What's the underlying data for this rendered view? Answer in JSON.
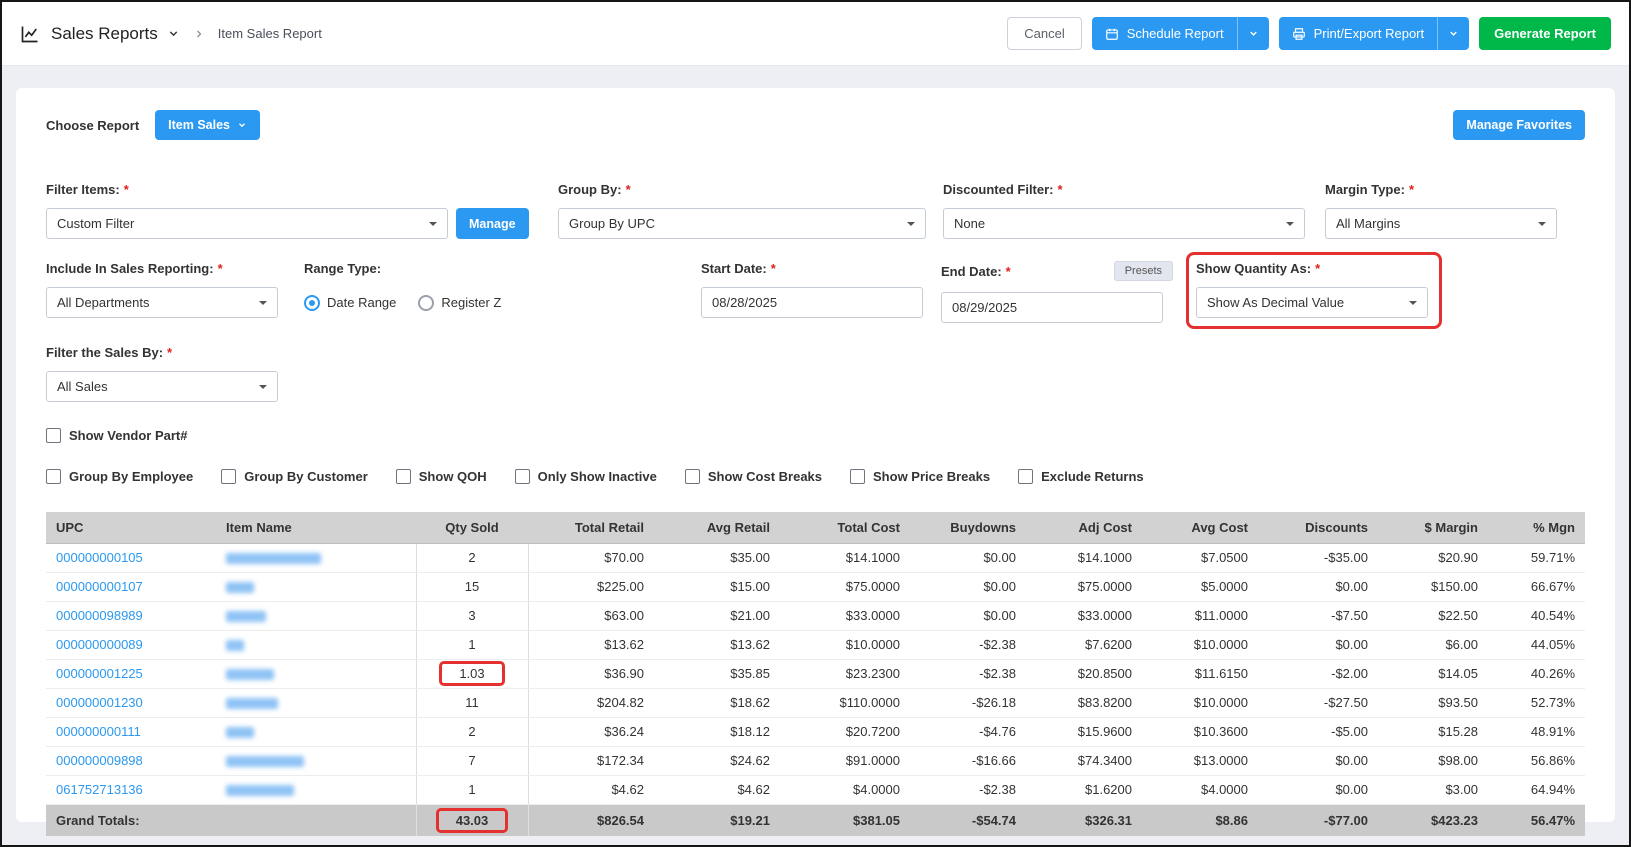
{
  "ui_colors": {
    "primary_blue": "#2b99f1",
    "success_green": "#00b74a",
    "annotation_red": "#e53030",
    "link_blue": "#2b99f1"
  },
  "required_marker": "*",
  "topbar": {
    "title": "Sales Reports",
    "breadcrumb": "Item Sales Report",
    "cancel": "Cancel",
    "schedule": "Schedule Report",
    "print_export": "Print/Export Report",
    "generate": "Generate Report"
  },
  "report_picker": {
    "label": "Choose Report",
    "selected": "Item Sales",
    "manage_favorites": "Manage Favorites"
  },
  "filters": {
    "filter_items": {
      "label": "Filter Items:",
      "value": "Custom Filter",
      "manage": "Manage"
    },
    "group_by": {
      "label": "Group By:",
      "value": "Group By UPC"
    },
    "discounted_filter": {
      "label": "Discounted Filter:",
      "value": "None"
    },
    "margin_type": {
      "label": "Margin Type:",
      "value": "All Margins"
    },
    "include_in_sales_reporting": {
      "label": "Include In Sales Reporting:",
      "value": "All Departments"
    },
    "range_type": {
      "label": "Range Type:",
      "options": [
        "Date Range",
        "Register Z"
      ],
      "selected": "Date Range"
    },
    "start_date": {
      "label": "Start Date:",
      "value": "08/28/2025"
    },
    "end_date": {
      "label": "End Date:",
      "value": "08/29/2025",
      "presets": "Presets"
    },
    "show_quantity_as": {
      "label": "Show Quantity As:",
      "value": "Show As Decimal Value"
    },
    "filter_sales_by": {
      "label": "Filter the Sales By:",
      "value": "All Sales"
    },
    "show_vendor_part": "Show Vendor Part#",
    "checkboxes": [
      "Group By Employee",
      "Group By Customer",
      "Show QOH",
      "Only Show Inactive",
      "Show Cost Breaks",
      "Show Price Breaks",
      "Exclude Returns"
    ]
  },
  "table": {
    "columns": [
      "UPC",
      "Item Name",
      "Qty Sold",
      "Total Retail",
      "Avg Retail",
      "Total Cost",
      "Buydowns",
      "Adj Cost",
      "Avg Cost",
      "Discounts",
      "$ Margin",
      "% Mgn"
    ],
    "rows": [
      {
        "upc": "000000000105",
        "item_name": "",
        "name_w": 95,
        "qty": "2",
        "qty_highlight": false,
        "total_retail": "$70.00",
        "avg_retail": "$35.00",
        "total_cost": "$14.1000",
        "buydowns": "$0.00",
        "adj_cost": "$14.1000",
        "avg_cost": "$7.0500",
        "discounts": "-$35.00",
        "margin": "$20.90",
        "pct_margin": "59.71%"
      },
      {
        "upc": "000000000107",
        "item_name": "",
        "name_w": 28,
        "qty": "15",
        "qty_highlight": false,
        "total_retail": "$225.00",
        "avg_retail": "$15.00",
        "total_cost": "$75.0000",
        "buydowns": "$0.00",
        "adj_cost": "$75.0000",
        "avg_cost": "$5.0000",
        "discounts": "$0.00",
        "margin": "$150.00",
        "pct_margin": "66.67%"
      },
      {
        "upc": "000000098989",
        "item_name": "",
        "name_w": 40,
        "qty": "3",
        "qty_highlight": false,
        "total_retail": "$63.00",
        "avg_retail": "$21.00",
        "total_cost": "$33.0000",
        "buydowns": "$0.00",
        "adj_cost": "$33.0000",
        "avg_cost": "$11.0000",
        "discounts": "-$7.50",
        "margin": "$22.50",
        "pct_margin": "40.54%"
      },
      {
        "upc": "000000000089",
        "item_name": "",
        "name_w": 18,
        "qty": "1",
        "qty_highlight": false,
        "total_retail": "$13.62",
        "avg_retail": "$13.62",
        "total_cost": "$10.0000",
        "buydowns": "-$2.38",
        "adj_cost": "$7.6200",
        "avg_cost": "$10.0000",
        "discounts": "$0.00",
        "margin": "$6.00",
        "pct_margin": "44.05%"
      },
      {
        "upc": "000000001225",
        "item_name": "",
        "name_w": 48,
        "qty": "1.03",
        "qty_highlight": true,
        "total_retail": "$36.90",
        "avg_retail": "$35.85",
        "total_cost": "$23.2300",
        "buydowns": "-$2.38",
        "adj_cost": "$20.8500",
        "avg_cost": "$11.6150",
        "discounts": "-$2.00",
        "margin": "$14.05",
        "pct_margin": "40.26%"
      },
      {
        "upc": "000000001230",
        "item_name": "",
        "name_w": 52,
        "qty": "11",
        "qty_highlight": false,
        "total_retail": "$204.82",
        "avg_retail": "$18.62",
        "total_cost": "$110.0000",
        "buydowns": "-$26.18",
        "adj_cost": "$83.8200",
        "avg_cost": "$10.0000",
        "discounts": "-$27.50",
        "margin": "$93.50",
        "pct_margin": "52.73%"
      },
      {
        "upc": "000000000111",
        "item_name": "",
        "name_w": 28,
        "qty": "2",
        "qty_highlight": false,
        "total_retail": "$36.24",
        "avg_retail": "$18.12",
        "total_cost": "$20.7200",
        "buydowns": "-$4.76",
        "adj_cost": "$15.9600",
        "avg_cost": "$10.3600",
        "discounts": "-$5.00",
        "margin": "$15.28",
        "pct_margin": "48.91%"
      },
      {
        "upc": "000000009898",
        "item_name": "",
        "name_w": 78,
        "qty": "7",
        "qty_highlight": false,
        "total_retail": "$172.34",
        "avg_retail": "$24.62",
        "total_cost": "$91.0000",
        "buydowns": "-$16.66",
        "adj_cost": "$74.3400",
        "avg_cost": "$13.0000",
        "discounts": "$0.00",
        "margin": "$98.00",
        "pct_margin": "56.86%"
      },
      {
        "upc": "061752713136",
        "item_name": "",
        "name_w": 68,
        "qty": "1",
        "qty_highlight": false,
        "total_retail": "$4.62",
        "avg_retail": "$4.62",
        "total_cost": "$4.0000",
        "buydowns": "-$2.38",
        "adj_cost": "$1.6200",
        "avg_cost": "$4.0000",
        "discounts": "$0.00",
        "margin": "$3.00",
        "pct_margin": "64.94%"
      }
    ],
    "grand_totals": {
      "label": "Grand Totals:",
      "qty": "43.03",
      "qty_highlight": true,
      "total_retail": "$826.54",
      "avg_retail": "$19.21",
      "total_cost": "$381.05",
      "buydowns": "-$54.74",
      "adj_cost": "$326.31",
      "avg_cost": "$8.86",
      "discounts": "-$77.00",
      "margin": "$423.23",
      "pct_margin": "56.47%"
    }
  }
}
